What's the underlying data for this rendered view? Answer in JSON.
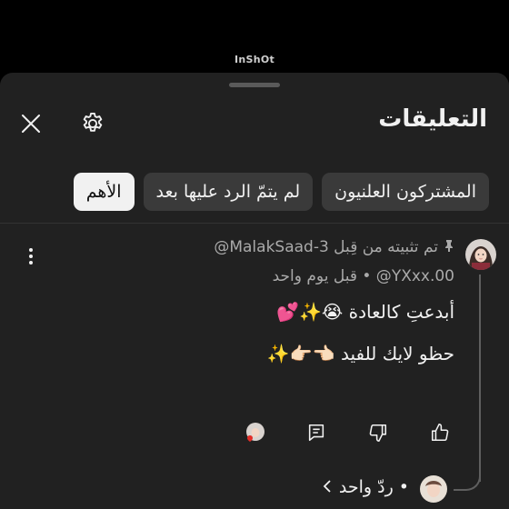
{
  "watermark": "InShOt",
  "header": {
    "title": "التعليقات"
  },
  "filters": [
    {
      "label": "الأهم",
      "active": true
    },
    {
      "label": "لم يتمّ الرد عليها بعد",
      "active": false
    },
    {
      "label": "المشتركون العلنيون",
      "active": false
    }
  ],
  "comment": {
    "pinned_text": "تم تثبيته من قِبل MalakSaad-3@",
    "author_meta": "YXxx.00@ • قبل يوم واحد",
    "line1": "أبدعتِ كالعادة 😭✨💕",
    "line2": "حظو لايك للفيد 👈🏻👉🏻✨"
  },
  "reply": {
    "label": "• ردّ واحد"
  },
  "icons": {
    "close": "close-icon",
    "settings": "gear-icon",
    "pin": "pin-icon",
    "more": "more-vert-icon",
    "like": "thumb-up-icon",
    "dislike": "thumb-down-icon",
    "reply": "comment-icon",
    "creator_heart": "creator-heart-icon",
    "chevron": "chevron-icon"
  },
  "colors": {
    "sheet_bg": "#212121",
    "chip_bg": "#3a3a3a",
    "chip_active_bg": "#f1f1f1",
    "heart": "#e52d27"
  }
}
